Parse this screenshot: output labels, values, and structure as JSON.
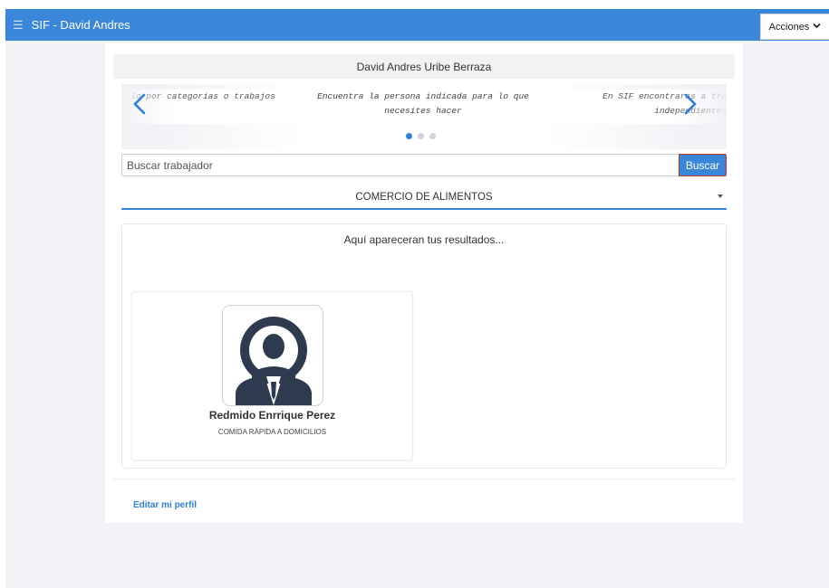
{
  "topbar": {
    "menu_icon": "hamburger-menu-icon",
    "title": "SIF - David Andres",
    "actions_label": "Acciones",
    "actions_icon": "chevron-down-icon"
  },
  "profile": {
    "full_name": "David Andres Uribe Berraza"
  },
  "carousel": {
    "slides": [
      "lo por categorias o trabajos",
      "Encuentra la persona indicada para lo que necesites hacer",
      "En SIF encontraras a tra independientes"
    ],
    "active_index": 0,
    "total": 3,
    "prev_icon": "chevron-left-icon",
    "next_icon": "chevron-right-icon"
  },
  "search": {
    "placeholder": "Buscar trabajador",
    "value": "",
    "button_label": "Buscar"
  },
  "category_select": {
    "selected": "COMERCIO DE ALIMENTOS"
  },
  "results": {
    "message": "Aquí apareceran tus resultados...",
    "cards": [
      {
        "name": "Redmido Enrrique Perez",
        "category": "COMIDA RÁPIDA A DOMICILIOS",
        "avatar_icon": "user-avatar-icon"
      }
    ]
  },
  "footer": {
    "edit_profile_label": "Editar mi perfil"
  },
  "colors": {
    "primary": "#3a86d9",
    "background": "#f2f3f6",
    "avatar_dark": "#2e3b4e"
  }
}
